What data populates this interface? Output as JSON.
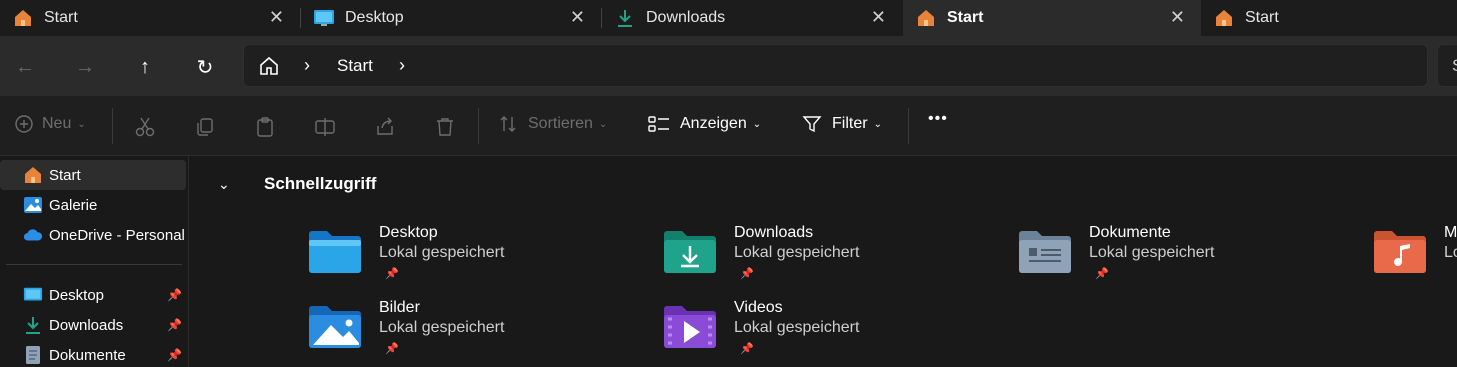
{
  "tabs": [
    {
      "label": "Start",
      "icon": "home-icon",
      "close": "✕"
    },
    {
      "label": "Desktop",
      "icon": "desktop-icon",
      "close": "✕"
    },
    {
      "label": "Downloads",
      "icon": "download-icon",
      "close": "✕"
    },
    {
      "label": "Start",
      "icon": "home-icon",
      "close": "✕",
      "active": true
    },
    {
      "label": "Start",
      "icon": "home-icon"
    }
  ],
  "nav": {
    "back": "←",
    "forward": "→",
    "up": "↑",
    "refresh": "↻",
    "chevron": "›",
    "breadcrumb": "Start",
    "search_label": "S"
  },
  "commands": {
    "new_label": "Neu",
    "sort_label": "Sortieren",
    "view_label": "Anzeigen",
    "filter_label": "Filter",
    "more_label": "•••",
    "caret": "⌄"
  },
  "sidebar": {
    "items": [
      {
        "label": "Start",
        "icon": "home-icon"
      },
      {
        "label": "Galerie",
        "icon": "gallery-icon"
      },
      {
        "label": "OneDrive - Personal",
        "icon": "cloud-icon"
      }
    ],
    "pinned": [
      {
        "label": "Desktop",
        "icon": "desktop-icon",
        "pin": "📌"
      },
      {
        "label": "Downloads",
        "icon": "download-icon",
        "pin": "📌"
      },
      {
        "label": "Dokumente",
        "icon": "document-icon",
        "pin": "📌"
      }
    ]
  },
  "main": {
    "section_title": "Schnellzugriff",
    "chevron": "⌄",
    "items": [
      {
        "name": "Desktop",
        "sub": "Lokal gespeichert",
        "icon": "desktop-folder-icon",
        "pin": "📌"
      },
      {
        "name": "Downloads",
        "sub": "Lokal gespeichert",
        "icon": "downloads-folder-icon",
        "pin": "📌"
      },
      {
        "name": "Dokumente",
        "sub": "Lokal gespeichert",
        "icon": "documents-folder-icon",
        "pin": "📌"
      },
      {
        "name": "M",
        "sub": "Lo",
        "icon": "music-folder-icon"
      },
      {
        "name": "Bilder",
        "sub": "Lokal gespeichert",
        "icon": "pictures-folder-icon",
        "pin": "📌"
      },
      {
        "name": "Videos",
        "sub": "Lokal gespeichert",
        "icon": "videos-folder-icon",
        "pin": "📌"
      }
    ]
  },
  "colors": {
    "accent": "#4cc2ff",
    "home_orange": "#e8833a",
    "downloads_green": "#1fa38a",
    "videos_purple": "#8a4bd6",
    "music_orange": "#e86a4a",
    "documents_grey": "#8fa3b8"
  }
}
